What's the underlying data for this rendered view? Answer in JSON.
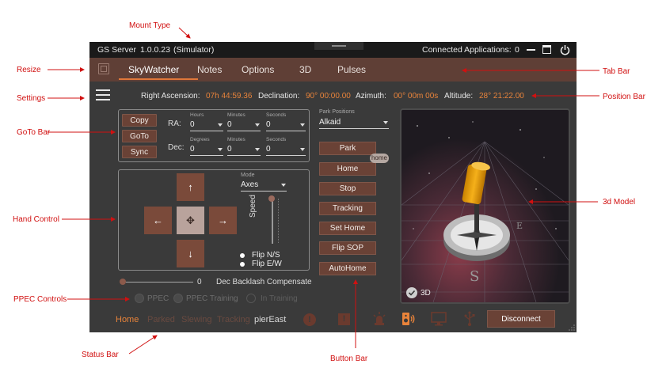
{
  "annotations": {
    "mount_type": "Mount Type",
    "resize": "Resize",
    "settings": "Settings",
    "goto_bar": "GoTo Bar",
    "hand_control": "Hand Control",
    "ppec_controls": "PPEC Controls",
    "status_bar": "Status Bar",
    "tab_bar": "Tab Bar",
    "position_bar": "Position Bar",
    "model_3d": "3d Model",
    "button_bar": "Button Bar"
  },
  "titlebar": {
    "app_name": "GS Server",
    "version": "1.0.0.23",
    "mode": "(Simulator)",
    "connected_label": "Connected Applications:",
    "connected_count": "0"
  },
  "tabs": [
    "SkyWatcher",
    "Notes",
    "Options",
    "3D",
    "Pulses"
  ],
  "position": {
    "ra_label": "Right Ascension:",
    "ra_value": "07h 44:59.36",
    "dec_label": "Declination:",
    "dec_value": "90° 00:00.00",
    "az_label": "Azimuth:",
    "az_value": "00° 00m 00s",
    "alt_label": "Altitude:",
    "alt_value": "28° 21:22.00"
  },
  "goto": {
    "copy": "Copy",
    "goto": "GoTo",
    "sync": "Sync",
    "ra_label": "RA:",
    "dec_label": "Dec:",
    "hours_label": "Hours",
    "minutes_label": "Minutes",
    "seconds_label": "Seconds",
    "degrees_label": "Degrees",
    "ra_hours": "0",
    "ra_minutes": "0",
    "ra_seconds": "0",
    "dec_degrees": "0",
    "dec_minutes": "0",
    "dec_seconds": "0"
  },
  "park": {
    "label": "Park Positions",
    "value": "Alkaid"
  },
  "hand": {
    "mode_label": "Mode",
    "mode_value": "Axes",
    "speed_label": "Speed",
    "flip_ns": "Flip N/S",
    "flip_ew": "Flip E/W",
    "up": "↑",
    "down": "↓",
    "left": "←",
    "right": "→",
    "center": "✥"
  },
  "backlash": {
    "value": "0",
    "label": "Dec Backlash Compensate"
  },
  "ppec": {
    "ppec": "PPEC",
    "training": "PPEC Training",
    "in_training": "In Training"
  },
  "buttons": {
    "park": "Park",
    "home": "Home",
    "home_badge": "home",
    "stop": "Stop",
    "tracking": "Tracking",
    "set_home": "Set Home",
    "flip_sop": "Flip SOP",
    "autohome": "AutoHome"
  },
  "model": {
    "label": "3D"
  },
  "status": {
    "home": "Home",
    "parked": "Parked",
    "slewing": "Slewing",
    "tracking": "Tracking",
    "pier": "pierEast",
    "disconnect": "Disconnect"
  },
  "colors": {
    "accent": "#e8833a",
    "tab_bar": "#5f3f36",
    "button": "#6a4236",
    "annotation": "#d11010"
  }
}
